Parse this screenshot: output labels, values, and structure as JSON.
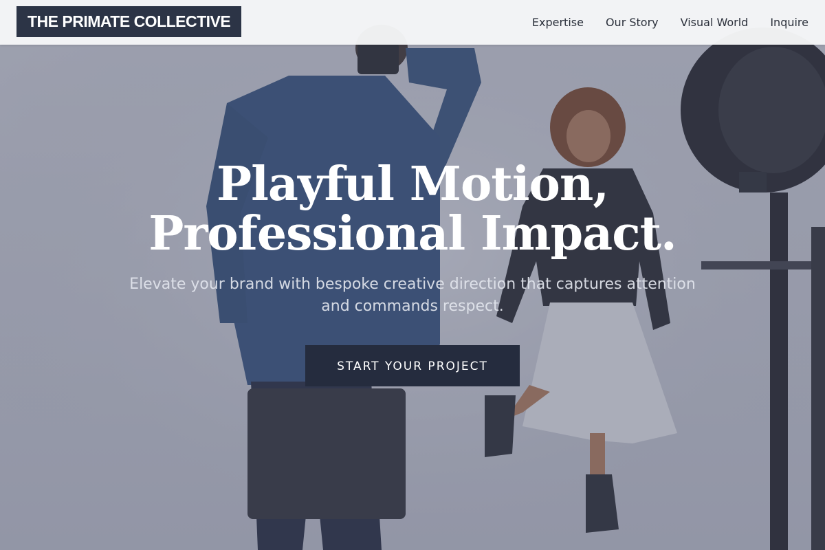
{
  "header": {
    "logo_text": "THE PRIMATE COLLECTIVE",
    "nav": [
      {
        "label": "Expertise"
      },
      {
        "label": "Our Story"
      },
      {
        "label": "Visual World"
      },
      {
        "label": "Inquire"
      }
    ]
  },
  "hero": {
    "title_line1": "Playful Motion,",
    "title_line2": "Professional Impact.",
    "subtitle": "Elevate your brand with bespoke creative direction that captures attention and commands respect.",
    "cta_label": "START YOUR PROJECT",
    "background_description": "photographer-shooting-smiling-model-in-studio-icon"
  },
  "colors": {
    "logo_bg": "#2c3446",
    "cta_bg": "#252c3e",
    "overlay": "#4e546c",
    "header_bg": "#f6f7f8"
  }
}
